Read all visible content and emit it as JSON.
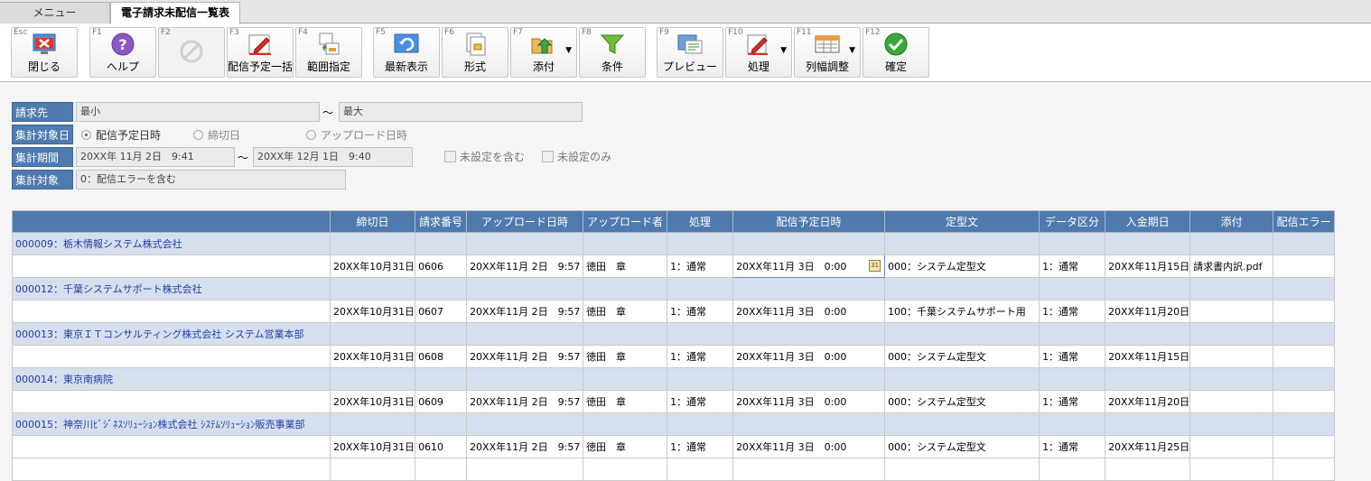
{
  "tabs": [
    {
      "label": "メニュー"
    },
    {
      "label": "電子請求未配信一覧表"
    }
  ],
  "toolbar": [
    {
      "key": "Esc",
      "label": "閉じる",
      "icon": "close-window-icon"
    },
    {
      "key": "F1",
      "label": "ヘルプ",
      "icon": "help-icon"
    },
    {
      "key": "F2",
      "label": "",
      "icon": "disabled-icon"
    },
    {
      "key": "F3",
      "label": "配信予定一括",
      "icon": "edit-pencil-icon"
    },
    {
      "key": "F4",
      "label": "範囲指定",
      "icon": "range-icon"
    },
    {
      "key": "F5",
      "label": "最新表示",
      "icon": "refresh-icon"
    },
    {
      "key": "F6",
      "label": "形式",
      "icon": "format-icon"
    },
    {
      "key": "F7",
      "label": "添付",
      "icon": "attach-folder-icon"
    },
    {
      "key": "F8",
      "label": "条件",
      "icon": "filter-icon"
    },
    {
      "key": "F9",
      "label": "プレビュー",
      "icon": "preview-icon"
    },
    {
      "key": "F10",
      "label": "処理",
      "icon": "process-pencil-icon"
    },
    {
      "key": "F11",
      "label": "列幅調整",
      "icon": "column-width-icon"
    },
    {
      "key": "F12",
      "label": "確定",
      "icon": "confirm-check-icon"
    }
  ],
  "criteria": {
    "billing_to": {
      "label": "請求先",
      "from": "最小",
      "to": "最大",
      "sep": "〜"
    },
    "target_date": {
      "label": "集計対象日",
      "options": [
        "配信予定日時",
        "締切日",
        "アップロード日時"
      ],
      "selected": 0
    },
    "period": {
      "label": "集計期間",
      "from": "20XX年 11月 2日　9:41",
      "to": "20XX年 12月 1日　9:40",
      "sep": "〜",
      "check_include_unset": "未設定を含む",
      "check_unset_only": "未設定のみ"
    },
    "target": {
      "label": "集計対象",
      "value": "0：配信エラーを含む"
    }
  },
  "grid": {
    "headers": [
      "",
      "締切日",
      "請求番号",
      "アップロード日時",
      "アップロード者",
      "処理",
      "配信予定日時",
      "定型文",
      "データ区分",
      "入金期日",
      "添付",
      "配信エラー"
    ],
    "groups": [
      {
        "name": "000009：栃木情報システム株式会社",
        "row": [
          "",
          "20XX年10月31日",
          "0606",
          "20XX年11月 2日　9:57",
          "徳田　章",
          "1：通常",
          "20XX年11月 3日　0:00",
          "000：システム定型文",
          "1：通常",
          "20XX年11月15日",
          "請求書内訳.pdf",
          ""
        ]
      },
      {
        "name": "000012：千葉システムサポート株式会社",
        "row": [
          "",
          "20XX年10月31日",
          "0607",
          "20XX年11月 2日　9:57",
          "徳田　章",
          "1：通常",
          "20XX年11月 3日　0:00",
          "100：千葉システムサポート用",
          "1：通常",
          "20XX年11月20日",
          "",
          ""
        ]
      },
      {
        "name": "000013：東京ＩＴコンサルティング株式会社 システム営業本部",
        "row": [
          "",
          "20XX年10月31日",
          "0608",
          "20XX年11月 2日　9:57",
          "徳田　章",
          "1：通常",
          "20XX年11月 3日　0:00",
          "000：システム定型文",
          "1：通常",
          "20XX年11月15日",
          "",
          ""
        ]
      },
      {
        "name": "000014：東京南病院",
        "row": [
          "",
          "20XX年10月31日",
          "0609",
          "20XX年11月 2日　9:57",
          "徳田　章",
          "1：通常",
          "20XX年11月 3日　0:00",
          "000：システム定型文",
          "1：通常",
          "20XX年11月20日",
          "",
          ""
        ]
      },
      {
        "name": "000015：神奈川ﾋﾞｼﾞﾈｽｿﾘｭｰｼｮﾝ株式会社 ｼｽﾃﾑｿﾘｭｰｼｮﾝ販売事業部",
        "row": [
          "",
          "20XX年10月31日",
          "0610",
          "20XX年11月 2日　9:57",
          "徳田　章",
          "1：通常",
          "20XX年11月 3日　0:00",
          "000：システム定型文",
          "1：通常",
          "20XX年11月25日",
          "",
          ""
        ]
      }
    ]
  }
}
